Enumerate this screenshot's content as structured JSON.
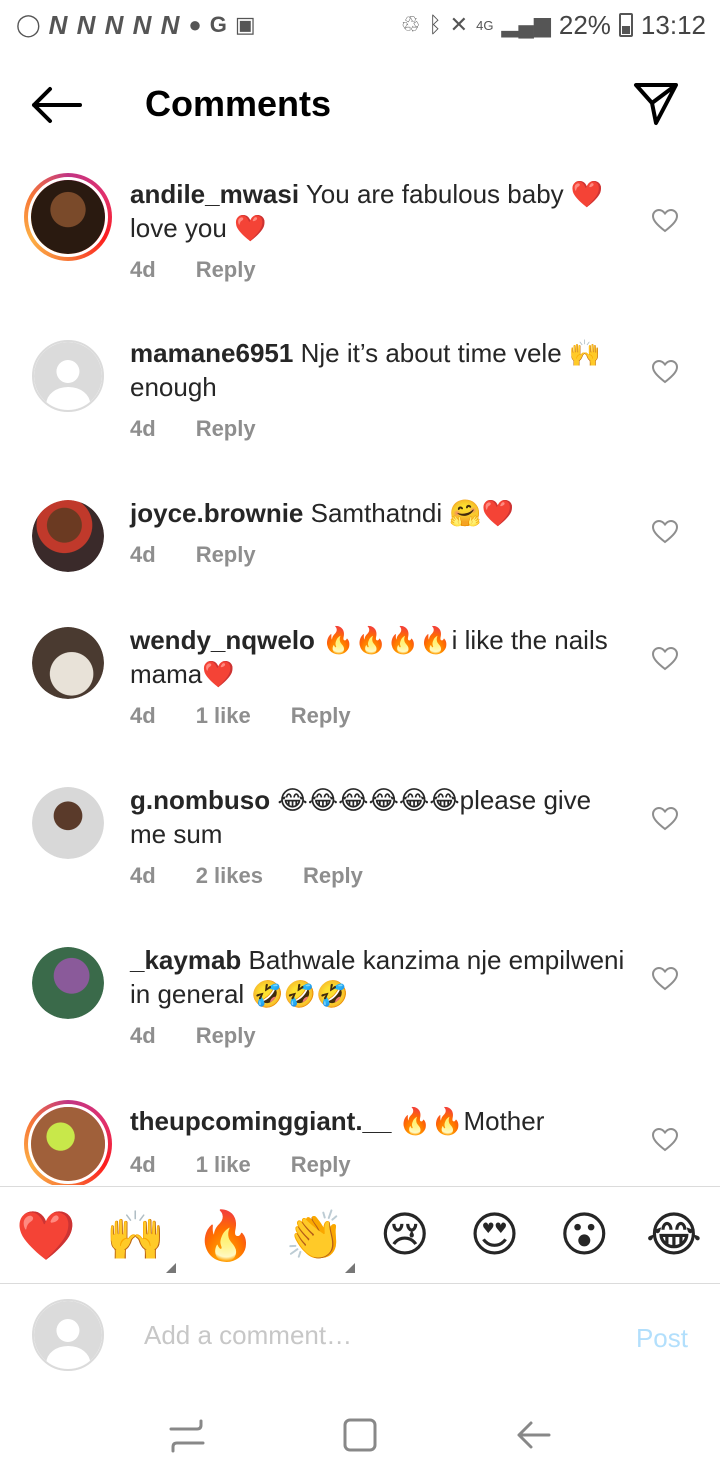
{
  "status_bar": {
    "left_letters": "N N N N N",
    "network": "4G",
    "battery": "22%",
    "time": "13:12"
  },
  "header": {
    "title": "Comments"
  },
  "comments": [
    {
      "username": "andile_mwasi",
      "text": "You are fabulous baby ❤️ love you ❤️",
      "time": "4d",
      "likes": "",
      "reply": "Reply",
      "avatar": "story"
    },
    {
      "username": "mamane6951",
      "text": "Nje it’s about time vele 🙌 enough",
      "time": "4d",
      "likes": "",
      "reply": "Reply",
      "avatar": "default"
    },
    {
      "username": "joyce.brownie",
      "text": "Samthatndi 🤗❤️",
      "time": "4d",
      "likes": "",
      "reply": "Reply",
      "avatar": "photo"
    },
    {
      "username": "wendy_nqwelo",
      "text": "🔥🔥🔥🔥i like the nails mama❤️",
      "time": "4d",
      "likes": "1 like",
      "reply": "Reply",
      "avatar": "photo"
    },
    {
      "username": "g.nombuso",
      "text": "😂😂😂😂😂😂please give me sum",
      "time": "4d",
      "likes": "2 likes",
      "reply": "Reply",
      "avatar": "photo"
    },
    {
      "username": "_kaymab",
      "text": "Bathwale kanzima nje empilweni in general 🤣🤣🤣",
      "time": "4d",
      "likes": "",
      "reply": "Reply",
      "avatar": "photo"
    },
    {
      "username": "theupcominggiant.__",
      "text": "🔥🔥Mother",
      "time": "4d",
      "likes": "1 like",
      "reply": "Reply",
      "avatar": "story"
    }
  ],
  "emoji_bar": [
    "❤️",
    "🙌",
    "🔥",
    "👏",
    "😢",
    "😍",
    "😮",
    "😂"
  ],
  "composer": {
    "placeholder": "Add a comment…",
    "post_label": "Post"
  },
  "colors": {
    "muted": "#8e8e8e",
    "post_disabled": "#b2dffc",
    "border": "#dbdbdb"
  }
}
